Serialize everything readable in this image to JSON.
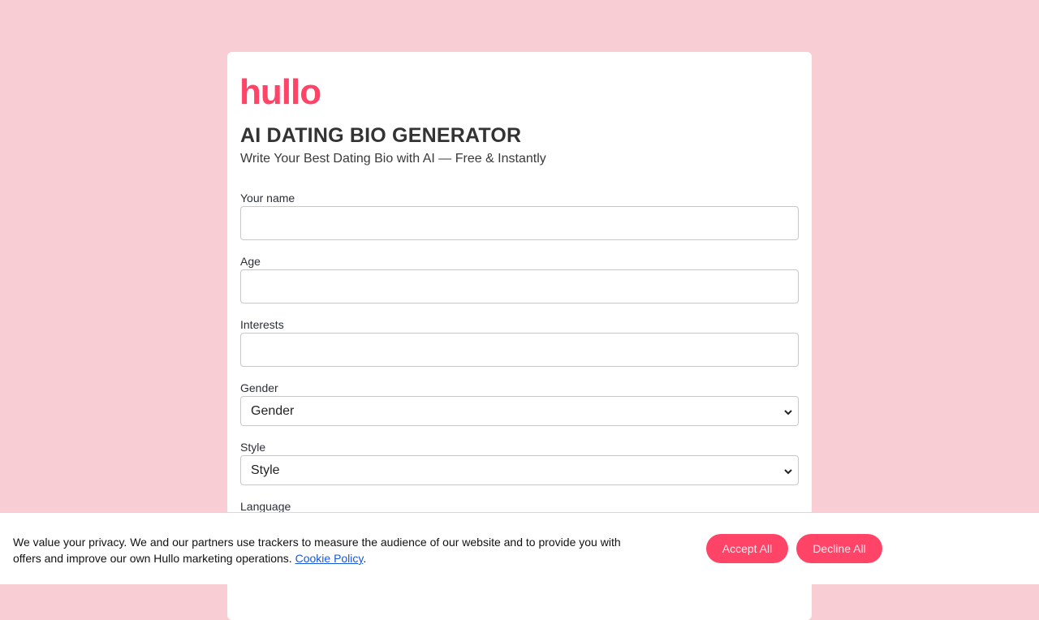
{
  "brand": {
    "logo_text": "hullo",
    "accent_color": "#ff4468",
    "background_color": "#f8cdd4"
  },
  "header": {
    "title": "AI DATING BIO GENERATOR",
    "subtitle": "Write Your Best Dating Bio with AI — Free & Instantly"
  },
  "form": {
    "name": {
      "label": "Your name",
      "value": "",
      "placeholder": ""
    },
    "age": {
      "label": "Age",
      "value": "",
      "placeholder": ""
    },
    "interests": {
      "label": "Interests",
      "value": "",
      "placeholder": ""
    },
    "gender": {
      "label": "Gender",
      "selected": "Gender"
    },
    "style": {
      "label": "Style",
      "selected": "Style"
    },
    "language": {
      "label": "Language"
    }
  },
  "cookie_banner": {
    "text": "We value your privacy. We and our partners use trackers to measure the audience of our website and to provide you with offers and improve our own Hullo marketing operations.",
    "link_text": "Cookie Policy",
    "trailing": ".",
    "accept_label": "Accept All",
    "decline_label": "Decline All"
  }
}
